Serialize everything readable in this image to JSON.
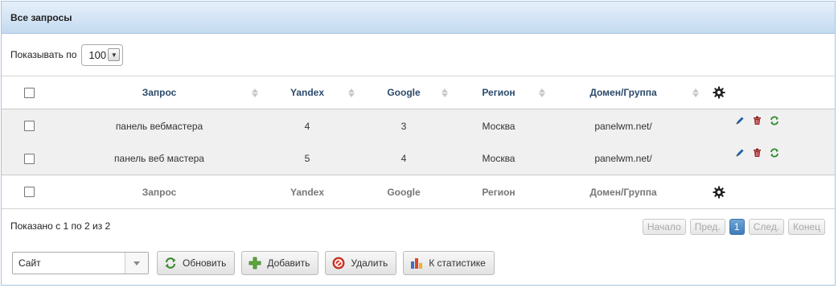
{
  "panel": {
    "title": "Все запросы"
  },
  "length": {
    "label": "Показывать по",
    "value": "100"
  },
  "columns": {
    "query": "Запрос",
    "yandex": "Yandex",
    "google": "Google",
    "region": "Регион",
    "domain": "Домен/Группа"
  },
  "rows": [
    {
      "query": "панель вебмастера",
      "yandex": "4",
      "google": "3",
      "region": "Москва",
      "domain": "panelwm.net/"
    },
    {
      "query": "панель веб мастера",
      "yandex": "5",
      "google": "4",
      "region": "Москва",
      "domain": "panelwm.net/"
    }
  ],
  "info": "Показано с 1 по 2 из 2",
  "pager": {
    "first": "Начало",
    "prev": "Пред.",
    "current": "1",
    "next": "След.",
    "last": "Конец"
  },
  "site_select": {
    "value": "Сайт"
  },
  "buttons": {
    "refresh": "Обновить",
    "add": "Добавить",
    "delete": "Удалить",
    "stats": "К статистике"
  },
  "colors": {
    "header_text": "#2b4a6b",
    "accent": "#3e7ab8",
    "edit": "#1f5fa8",
    "trash": "#8b1a1a",
    "refresh": "#2e8b2e"
  },
  "icons": [
    "gear-icon",
    "edit-icon",
    "trash-icon",
    "refresh-icon",
    "plus-icon",
    "delete-icon",
    "chart-icon"
  ]
}
